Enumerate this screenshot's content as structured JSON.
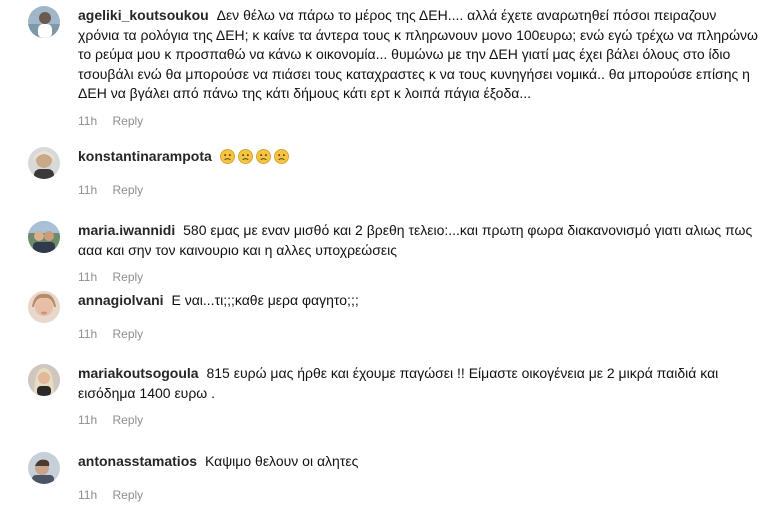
{
  "comments": [
    {
      "username": "ageliki_koutsoukou",
      "text": "Δεν θέλω να πάρω το μέρος της ΔΕΗ.... αλλά έχετε αναρωτηθεί πόσοι πειραζουν χρόνια τα ρολόγια της ΔΕΗ; κ καίνε τα άντερα τους κ πληρωνουν μονο 100ευρω; ενώ εγώ τρέχω να πληρώνω το ρεύμα μου κ προσπαθώ να κάνω κ οικονομία... θυμώνω με την ΔΕΗ γιατί μας έχει βάλει όλους στο ίδιο τσουβάλι ενώ θα μπορούσε να πιάσει τους καταχραστες κ να τους κυνηγήσει νομικά.. θα μπορούσε επίσης η ΔΕΗ να βγάλει από πάνω της κάτι δήμους κάτι ερτ κ λοιπά πάγια έξοδα...",
      "time": "11h",
      "reply": "Reply"
    },
    {
      "username": "konstantinarampota",
      "text": "",
      "emojis": [
        "crying-face-icon",
        "crying-face-icon",
        "crying-face-icon",
        "crying-face-icon"
      ],
      "time": "11h",
      "reply": "Reply"
    },
    {
      "username": "maria.iwannidi",
      "text": "580 εμας με εναν μισθό και 2 βρεθη τελειο:...και πρωτη φωρα διακανονισμό γιατι αλιως πως ααα και σην τον καινουριο και η αλλες υποχρεώσεις",
      "time": "11h",
      "reply": "Reply"
    },
    {
      "username": "annagiolvani",
      "text": "Ε ναι...τι;;;καθε μερα φαγητο;;;",
      "time": "11h",
      "reply": "Reply"
    },
    {
      "username": "mariakoutsogoula",
      "text": "815 ευρώ μας ήρθε και έχουμε παγώσει !! Είμαστε οικογένεια με 2 μικρά παιδιά και εισόδημα 1400 ευρω .",
      "time": "11h",
      "reply": "Reply"
    },
    {
      "username": "antonasstamatios",
      "text": "Καψιμο θελουν οι αλητες",
      "time": "11h",
      "reply": "Reply"
    }
  ]
}
